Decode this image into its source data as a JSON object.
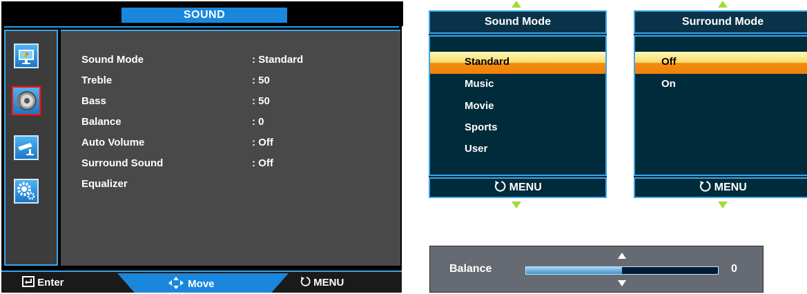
{
  "main_menu": {
    "title": "SOUND",
    "rows": [
      {
        "label": "Sound Mode",
        "value": ": Standard"
      },
      {
        "label": "Treble",
        "value": ": 50"
      },
      {
        "label": "Bass",
        "value": ": 50"
      },
      {
        "label": "Balance",
        "value": ": 0"
      },
      {
        "label": "Auto Volume",
        "value": ": Off"
      },
      {
        "label": "Surround Sound",
        "value": ": Off"
      },
      {
        "label": "Equalizer",
        "value": ""
      }
    ],
    "side_icons": [
      {
        "name": "picture-icon",
        "selected": false
      },
      {
        "name": "speaker-icon",
        "selected": true
      },
      {
        "name": "camera-icon",
        "selected": false
      },
      {
        "name": "settings-gears-icon",
        "selected": false
      }
    ],
    "footer": {
      "enter": "Enter",
      "move": "Move",
      "menu": "MENU"
    }
  },
  "sound_mode_menu": {
    "title": "Sound Mode",
    "options": [
      "Standard",
      "Music",
      "Movie",
      "Sports",
      "User"
    ],
    "selected_index": 0,
    "footer": "MENU"
  },
  "surround_mode_menu": {
    "title": "Surround Mode",
    "options": [
      "Off",
      "On"
    ],
    "selected_index": 0,
    "footer": "MENU"
  },
  "balance_slider": {
    "label": "Balance",
    "value": "0",
    "fill_fraction": 0.5
  },
  "colors": {
    "accent_blue": "#1a87dc",
    "highlight_orange": "#f58a0e",
    "arrow_green": "#a4d935"
  }
}
